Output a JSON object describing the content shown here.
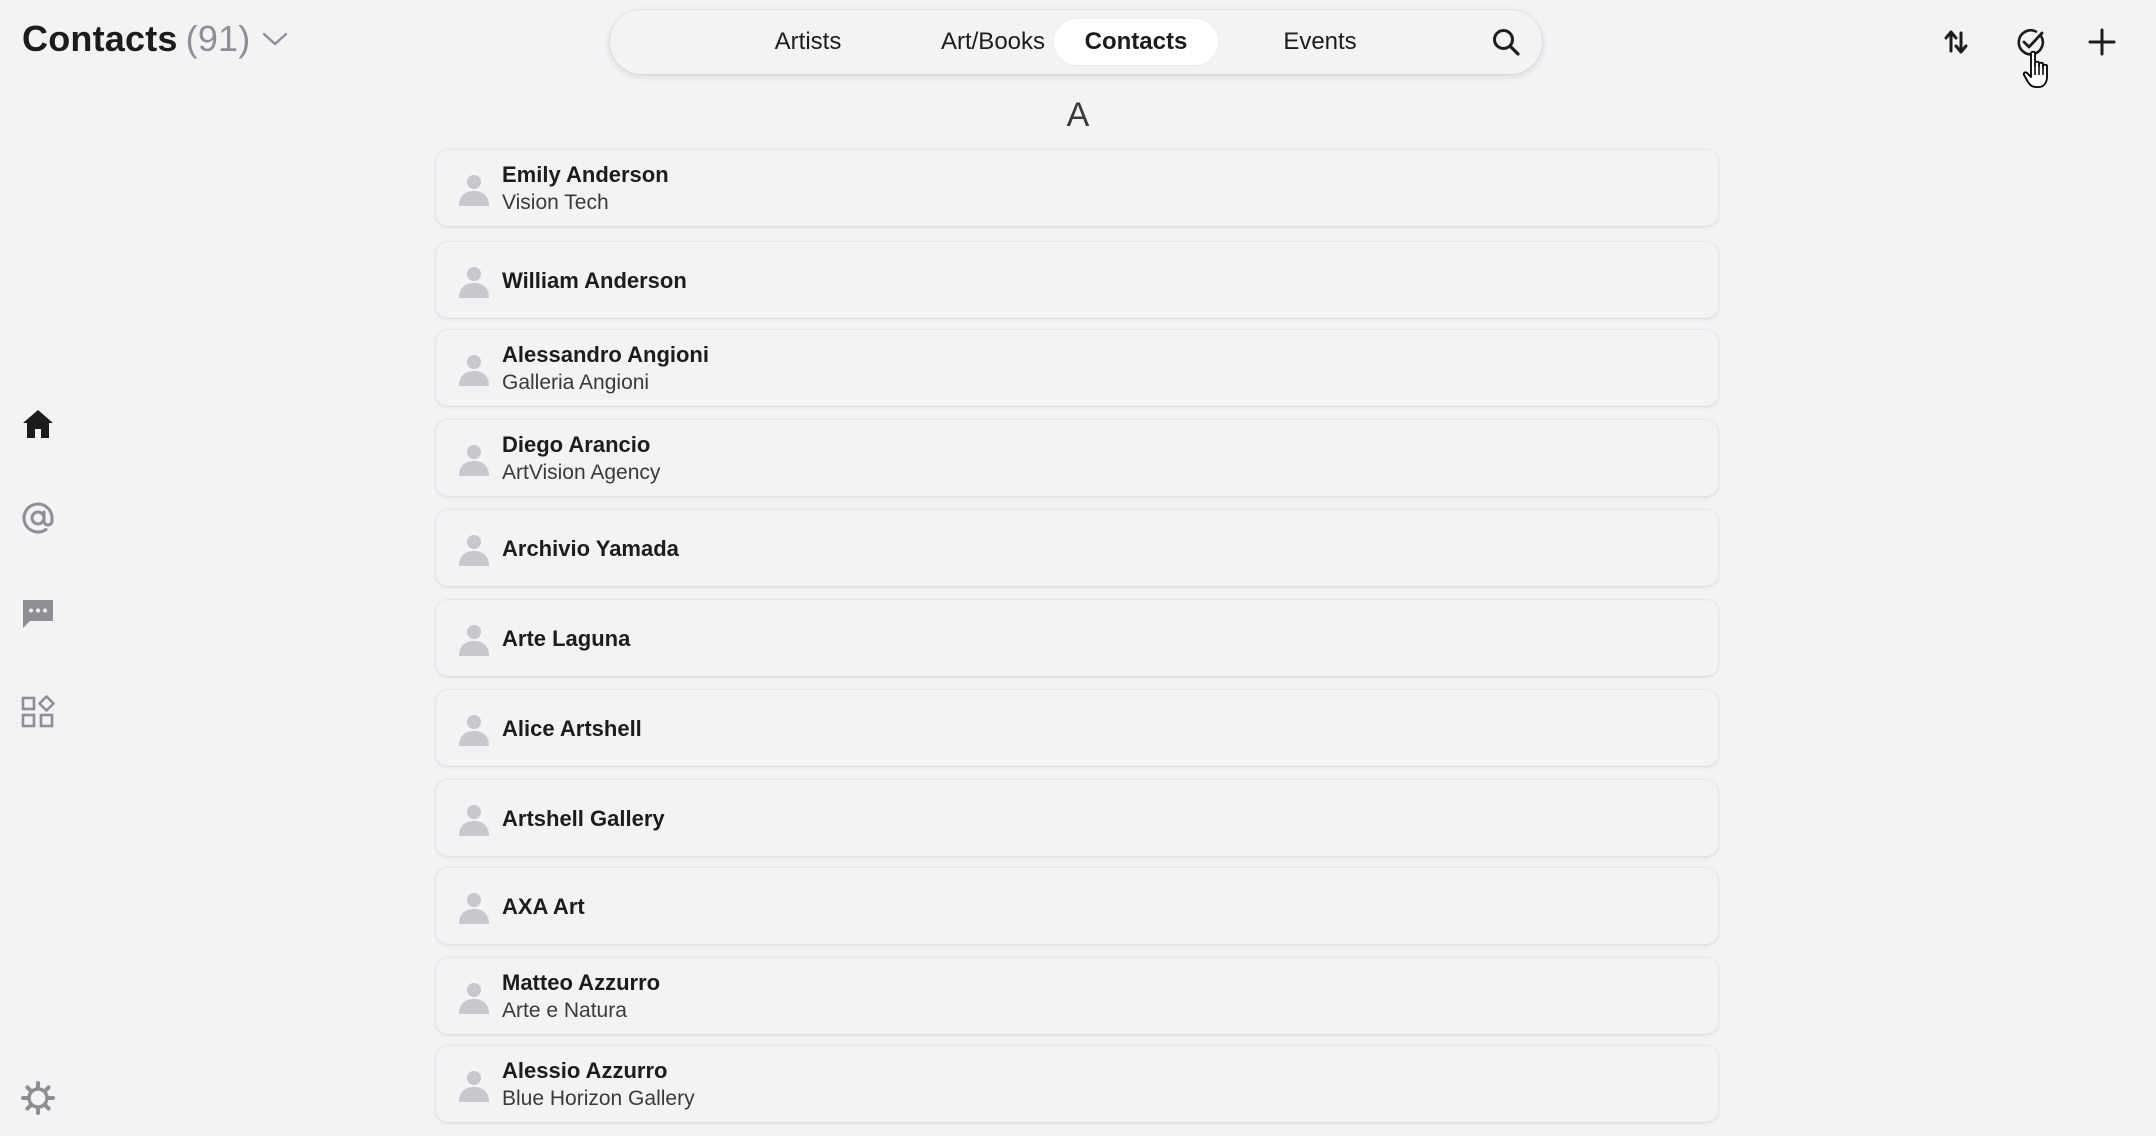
{
  "header": {
    "title": "Contacts",
    "count": "(91)",
    "dropdown_icon": "chevron-down-icon"
  },
  "nav": {
    "tabs": [
      {
        "label": "Artists",
        "active": false
      },
      {
        "label": "Art/Books",
        "active": false
      },
      {
        "label": "Contacts",
        "active": true
      },
      {
        "label": "Events",
        "active": false
      }
    ],
    "search_icon": "search-icon"
  },
  "actions": {
    "sort_icon": "sort-arrows-icon",
    "select_icon": "check-circle-icon",
    "add_icon": "plus-icon"
  },
  "sidebar": {
    "items": [
      {
        "icon": "home-icon"
      },
      {
        "icon": "at-sign-icon"
      },
      {
        "icon": "chat-bubble-icon"
      },
      {
        "icon": "apps-grid-icon"
      },
      {
        "icon": "gear-icon"
      }
    ]
  },
  "list": {
    "section": "A",
    "contacts": [
      {
        "name": "Emily Anderson",
        "company": "Vision Tech"
      },
      {
        "name": "William Anderson",
        "company": ""
      },
      {
        "name": "Alessandro Angioni",
        "company": "Galleria Angioni"
      },
      {
        "name": "Diego Arancio",
        "company": "ArtVision Agency"
      },
      {
        "name": "Archivio Yamada",
        "company": ""
      },
      {
        "name": "Arte Laguna",
        "company": ""
      },
      {
        "name": "Alice Artshell",
        "company": ""
      },
      {
        "name": "Artshell Gallery",
        "company": ""
      },
      {
        "name": "AXA Art",
        "company": ""
      },
      {
        "name": "Matteo Azzurro",
        "company": "Arte e Natura"
      },
      {
        "name": "Alessio Azzurro",
        "company": "Blue Horizon Gallery"
      }
    ]
  },
  "colors": {
    "background": "#f3f3f6",
    "text": "#1c1c1e",
    "muted": "#8e8e93",
    "avatar": "#c7c7cc"
  }
}
